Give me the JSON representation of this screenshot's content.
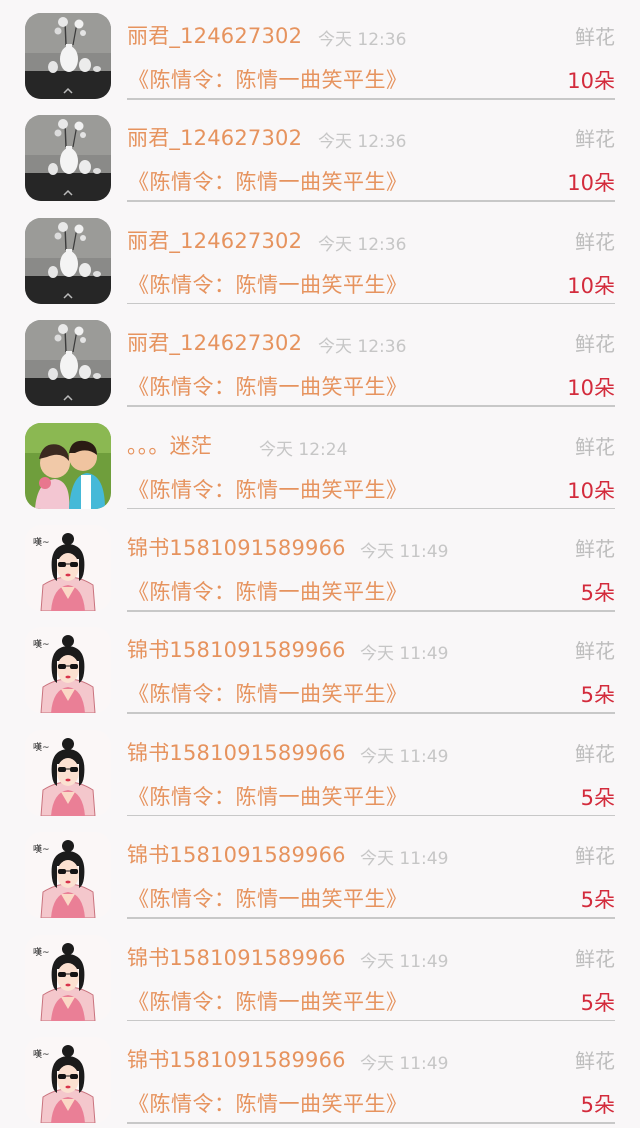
{
  "rows": [
    {
      "avatar": "vase-photo-avatar",
      "name": "丽君_124627302",
      "time": "今天 12:36",
      "gift": "鲜花",
      "book": "《陈情令：陈情一曲笑平生》",
      "count": "10朵"
    },
    {
      "avatar": "vase-photo-avatar",
      "name": "丽君_124627302",
      "time": "今天 12:36",
      "gift": "鲜花",
      "book": "《陈情令：陈情一曲笑平生》",
      "count": "10朵"
    },
    {
      "avatar": "vase-photo-avatar",
      "name": "丽君_124627302",
      "time": "今天 12:36",
      "gift": "鲜花",
      "book": "《陈情令：陈情一曲笑平生》",
      "count": "10朵"
    },
    {
      "avatar": "vase-photo-avatar",
      "name": "丽君_124627302",
      "time": "今天 12:36",
      "gift": "鲜花",
      "book": "《陈情令：陈情一曲笑平生》",
      "count": "10朵"
    },
    {
      "avatar": "couple-photo-avatar",
      "name": "。。。迷茫",
      "time": "今天 12:24",
      "gift": "鲜花",
      "book": "《陈情令：陈情一曲笑平生》",
      "count": "10朵"
    },
    {
      "avatar": "cartoon-girl-avatar",
      "name": "锦书1581091589966",
      "time": "今天 11:49",
      "gift": "鲜花",
      "book": "《陈情令：陈情一曲笑平生》",
      "count": "5朵"
    },
    {
      "avatar": "cartoon-girl-avatar",
      "name": "锦书1581091589966",
      "time": "今天 11:49",
      "gift": "鲜花",
      "book": "《陈情令：陈情一曲笑平生》",
      "count": "5朵"
    },
    {
      "avatar": "cartoon-girl-avatar",
      "name": "锦书1581091589966",
      "time": "今天 11:49",
      "gift": "鲜花",
      "book": "《陈情令：陈情一曲笑平生》",
      "count": "5朵"
    },
    {
      "avatar": "cartoon-girl-avatar",
      "name": "锦书1581091589966",
      "time": "今天 11:49",
      "gift": "鲜花",
      "book": "《陈情令：陈情一曲笑平生》",
      "count": "5朵"
    },
    {
      "avatar": "cartoon-girl-avatar",
      "name": "锦书1581091589966",
      "time": "今天 11:49",
      "gift": "鲜花",
      "book": "《陈情令：陈情一曲笑平生》",
      "count": "5朵"
    },
    {
      "avatar": "cartoon-girl-avatar",
      "name": "锦书1581091589966",
      "time": "今天 11:49",
      "gift": "鲜花",
      "book": "《陈情令：陈情一曲笑平生》",
      "count": "5朵"
    }
  ],
  "colors": {
    "name": "#e6935e",
    "book": "#e6935e",
    "count": "#d32b3c",
    "muted": "#c6c6c6",
    "background": "#f9f7f8"
  }
}
